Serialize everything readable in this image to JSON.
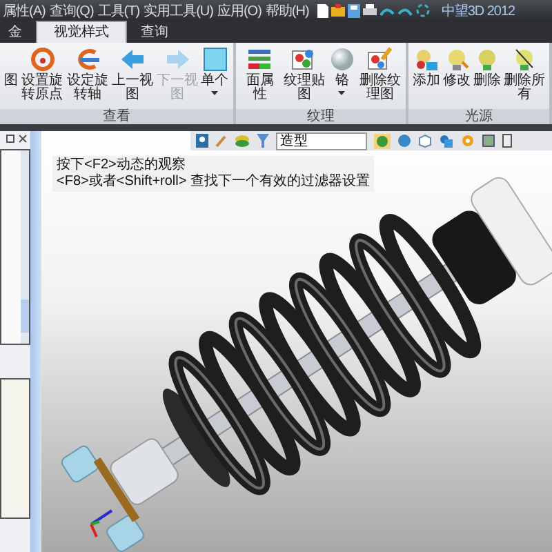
{
  "menu": [
    "属性(A)",
    "查询(Q)",
    "工具(T)",
    "实用工具(U)",
    "应用(O)",
    "帮助(H)"
  ],
  "app_title": "中望3D 2012",
  "tabs": [
    {
      "label": "金",
      "selected": false
    },
    {
      "label": "视觉样式",
      "selected": true
    },
    {
      "label": "查询",
      "selected": false
    }
  ],
  "ribbon": {
    "groups": [
      {
        "label": "查看",
        "buttons": [
          {
            "label": "图",
            "disabled": false,
            "dropdown": false
          },
          {
            "label": "设置旋转原点",
            "disabled": false,
            "dropdown": false
          },
          {
            "label": "设定旋转轴",
            "disabled": false,
            "dropdown": false
          },
          {
            "label": "上一视图",
            "disabled": false,
            "dropdown": false
          },
          {
            "label": "下一视图",
            "disabled": true,
            "dropdown": false
          },
          {
            "label": "单个",
            "disabled": false,
            "dropdown": true
          }
        ]
      },
      {
        "label": "纹理",
        "buttons": [
          {
            "label": "面属性",
            "disabled": false,
            "dropdown": false
          },
          {
            "label": "纹理贴图",
            "disabled": false,
            "dropdown": false
          },
          {
            "label": "铬",
            "disabled": false,
            "dropdown": true
          },
          {
            "label": "删除纹理图",
            "disabled": false,
            "dropdown": false
          }
        ]
      },
      {
        "label": "光源",
        "buttons": [
          {
            "label": "添加",
            "disabled": false,
            "dropdown": false
          },
          {
            "label": "修改",
            "disabled": false,
            "dropdown": false
          },
          {
            "label": "删除",
            "disabled": false,
            "dropdown": false
          },
          {
            "label": "删除所有",
            "disabled": false,
            "dropdown": false
          }
        ]
      }
    ]
  },
  "viewport": {
    "filter": "造型",
    "hints": [
      "按下<F2>动态的观察",
      "<F8>或者<Shift+roll> 查找下一个有效的过滤器设置"
    ]
  }
}
